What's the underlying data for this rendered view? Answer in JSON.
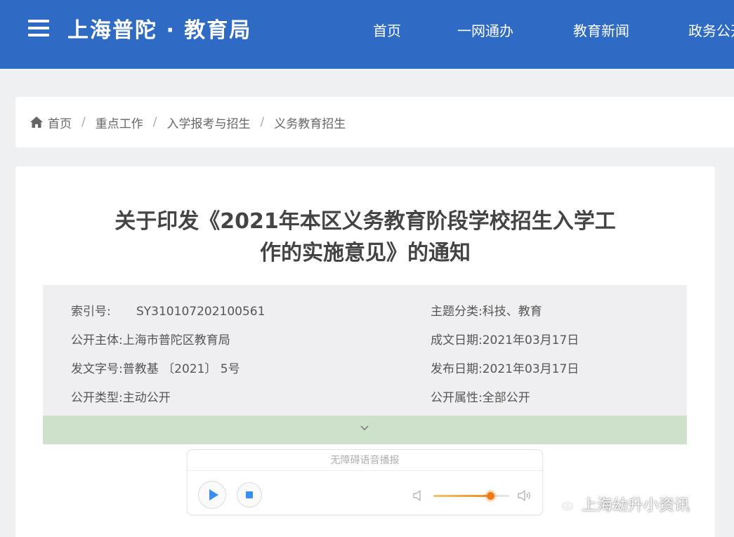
{
  "header": {
    "site_title": "上海普陀 · 教育局",
    "nav": [
      "首页",
      "一网通办",
      "教育新闻",
      "政务公开"
    ]
  },
  "breadcrumb": {
    "items": [
      "首页",
      "重点工作",
      "入学报考与招生",
      "义务教育招生"
    ],
    "separator": "/"
  },
  "article": {
    "title_line1": "关于印发《2021年本区义务教育阶段学校招生入学工",
    "title_line2": "作的实施意见》的通知",
    "meta": {
      "index_no": {
        "label": "索引号:",
        "value": "SY310107202100561"
      },
      "subject": {
        "label": "主题分类:",
        "value": "科技、教育"
      },
      "publisher": {
        "label": "公开主体:",
        "value": "上海市普陀区教育局"
      },
      "written_date": {
        "label": "成文日期:",
        "value": "2021年03月17日"
      },
      "doc_no": {
        "label": "发文字号:",
        "value": "普教基 〔2021〕 5号"
      },
      "publish_date": {
        "label": "发布日期:",
        "value": "2021年03月17日"
      },
      "open_type": {
        "label": "公开类型:",
        "value": "主动公开"
      },
      "open_attr": {
        "label": "公开属性:",
        "value": "全部公开"
      }
    }
  },
  "player": {
    "title": "无障碍语音播报",
    "volume_level": 0.75
  },
  "watermark": {
    "text": "上海幼升小资讯"
  },
  "colors": {
    "header_bg": "#2f6bc4",
    "expand_bar": "#cde1cb",
    "accent_blue": "#3a8ef0",
    "slider_orange": "#f07a12"
  },
  "icons": [
    "menu-icon",
    "home-icon",
    "chevron-down-icon",
    "play-icon",
    "stop-icon",
    "volume-low-icon",
    "volume-high-icon",
    "wechat-icon"
  ]
}
